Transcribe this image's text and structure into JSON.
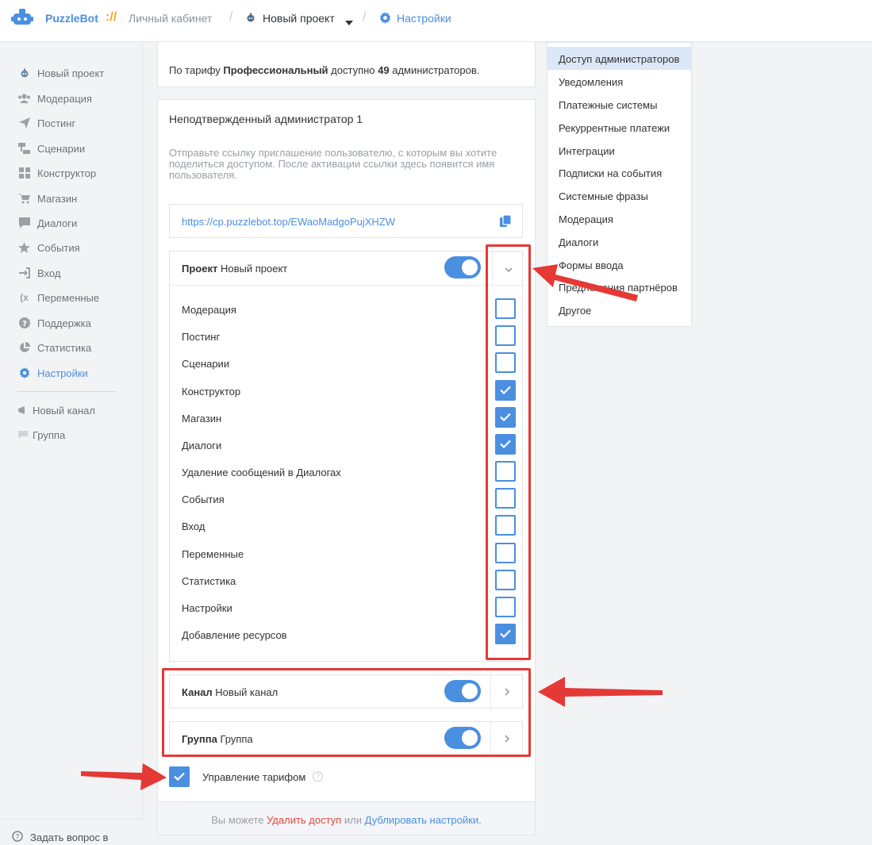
{
  "header": {
    "brand": "PuzzleBot",
    "brand_sep": "://",
    "breadcrumb_cabinet": "Личный кабинет",
    "breadcrumb_project": "Новый проект",
    "breadcrumb_settings": "Настройки"
  },
  "sidebar": {
    "items": [
      {
        "label": "Новый проект",
        "icon": "bot-icon"
      },
      {
        "label": "Модерация",
        "icon": "users-icon"
      },
      {
        "label": "Постинг",
        "icon": "send-icon"
      },
      {
        "label": "Сценарии",
        "icon": "scenario-icon"
      },
      {
        "label": "Конструктор",
        "icon": "grid-icon"
      },
      {
        "label": "Магазин",
        "icon": "cart-icon"
      },
      {
        "label": "Диалоги",
        "icon": "chat-icon"
      },
      {
        "label": "События",
        "icon": "star-icon"
      },
      {
        "label": "Вход",
        "icon": "login-icon"
      },
      {
        "label": "Переменные",
        "icon": "variable-icon"
      },
      {
        "label": "Поддержка",
        "icon": "help-icon"
      },
      {
        "label": "Статистика",
        "icon": "pie-icon"
      },
      {
        "label": "Настройки",
        "icon": "gear-icon"
      }
    ],
    "channels": [
      {
        "label": "Новый канал",
        "icon": "channel-icon"
      },
      {
        "label": "Группа",
        "icon": "group-icon"
      }
    ],
    "ask_label": "Задать вопрос в"
  },
  "plan": {
    "prefix": "По тарифу ",
    "name": "Профессиональный",
    "middle": " доступно ",
    "count": "49",
    "suffix": " администраторов."
  },
  "admin": {
    "title": "Неподтвержденный администратор 1",
    "description": "Отправьте ссылку приглашение пользователю, с которым вы хотите поделиться доступом. После активации ссылки здесь появится имя пользователя.",
    "invite_link": "https://cp.puzzlebot.top/EWaoMadgoPujXHZW"
  },
  "project_section": {
    "kind": "Проект",
    "name": "Новый проект",
    "enabled": true,
    "permissions": [
      {
        "label": "Модерация",
        "checked": false
      },
      {
        "label": "Постинг",
        "checked": false
      },
      {
        "label": "Сценарии",
        "checked": false
      },
      {
        "label": "Конструктор",
        "checked": true
      },
      {
        "label": "Магазин",
        "checked": true
      },
      {
        "label": "Диалоги",
        "checked": true
      },
      {
        "label": "Удаление сообщений в Диалогах",
        "checked": false
      },
      {
        "label": "События",
        "checked": false
      },
      {
        "label": "Вход",
        "checked": false
      },
      {
        "label": "Переменные",
        "checked": false
      },
      {
        "label": "Статистика",
        "checked": false
      },
      {
        "label": "Настройки",
        "checked": false
      },
      {
        "label": "Добавление ресурсов",
        "checked": true
      }
    ]
  },
  "channel_section": {
    "kind": "Канал",
    "name": "Новый канал",
    "enabled": true
  },
  "group_section": {
    "kind": "Группа",
    "name": "Группа",
    "enabled": true
  },
  "tariff": {
    "label": "Управление тарифом",
    "checked": true,
    "help": "?"
  },
  "footer": {
    "prefix": "Вы можете ",
    "delete_link": "Удалить доступ",
    "middle": " или ",
    "duplicate_link": "Дублировать настройки",
    "suffix": "."
  },
  "right_menu": {
    "items": [
      {
        "label": "Доступ администраторов",
        "active": true
      },
      {
        "label": "Уведомления",
        "active": false
      },
      {
        "label": "Платежные системы",
        "active": false
      },
      {
        "label": "Рекуррентные платежи",
        "active": false
      },
      {
        "label": "Интеграции",
        "active": false
      },
      {
        "label": "Подписки на события",
        "active": false
      },
      {
        "label": "Системные фразы",
        "active": false
      },
      {
        "label": "Модерация",
        "active": false
      },
      {
        "label": "Диалоги",
        "active": false
      },
      {
        "label": "Формы ввода",
        "active": false
      },
      {
        "label": "Предложения партнёров",
        "active": false
      },
      {
        "label": "Другое",
        "active": false
      }
    ]
  },
  "colors": {
    "accent": "#4a8fe0",
    "annotation_red": "#e53935",
    "brand_orange": "#f5a623"
  }
}
